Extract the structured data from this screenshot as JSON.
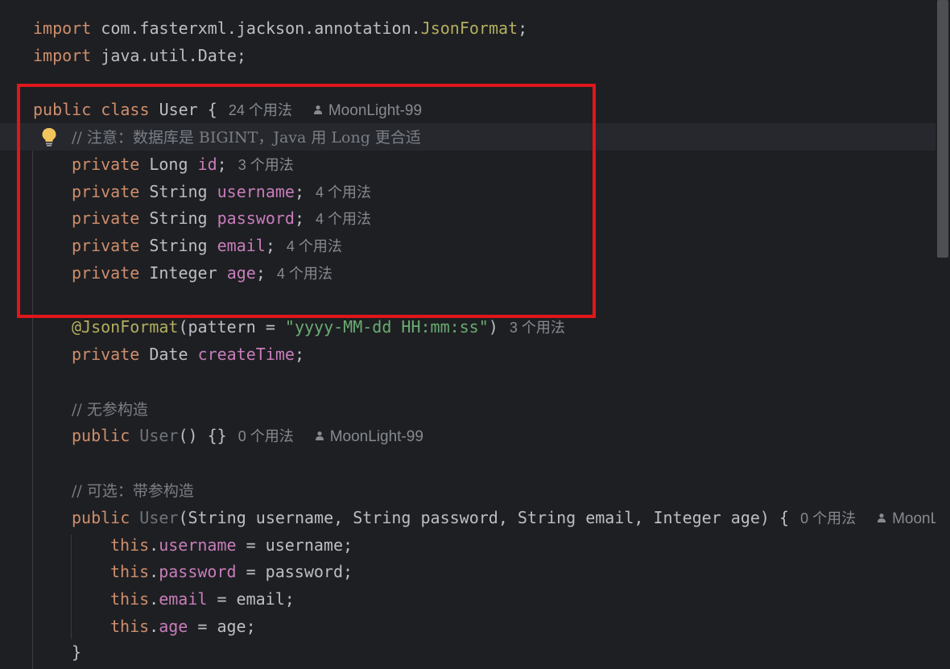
{
  "lines": {
    "l1": {
      "kw": "import",
      "rest": " com.fasterxml.jackson.annotation.",
      "cls": "JsonFormat",
      "end": ";"
    },
    "l2": {
      "kw": "import",
      "rest": " java.util.Date;"
    },
    "l3": {
      "kw1": "public",
      "kw2": "class",
      "name": "User",
      "brace": "{",
      "hint": "24 个用法",
      "author": "MoonLight-99"
    },
    "l4": {
      "comment": "// 注意：数据库是 BIGINT，Java 用 Long 更合适"
    },
    "l5": {
      "kw": "private",
      "type": "Long",
      "field": "id",
      "end": ";",
      "hint": "3 个用法"
    },
    "l6": {
      "kw": "private",
      "type": "String",
      "field": "username",
      "end": ";",
      "hint": "4 个用法"
    },
    "l7": {
      "kw": "private",
      "type": "String",
      "field": "password",
      "end": ";",
      "hint": "4 个用法"
    },
    "l8": {
      "kw": "private",
      "type": "String",
      "field": "email",
      "end": ";",
      "hint": "4 个用法"
    },
    "l9": {
      "kw": "private",
      "type": "Integer",
      "field": "age",
      "end": ";",
      "hint": "4 个用法"
    },
    "l11": {
      "ann": "@JsonFormat",
      "open": "(pattern = ",
      "str": "\"yyyy-MM-dd HH:mm:ss\"",
      "close": ")",
      "hint": "3 个用法"
    },
    "l12": {
      "kw": "private",
      "type": "Date",
      "field": "createTime",
      "end": ";"
    },
    "l14": {
      "comment": "// 无参构造"
    },
    "l15": {
      "kw": "public",
      "name": "User",
      "rest": "() {}",
      "hint": "0 个用法",
      "author": "MoonLight-99"
    },
    "l17": {
      "comment": "// 可选：带参构造"
    },
    "l18": {
      "kw": "public",
      "name": "User",
      "rest": "(String username, String password, String email, Integer age) {",
      "hint": "0 个用法",
      "author": "MoonLi"
    },
    "l19": {
      "kw": "this",
      "dot": ".",
      "field": "username",
      "rest": " = username;"
    },
    "l20": {
      "kw": "this",
      "dot": ".",
      "field": "password",
      "rest": " = password;"
    },
    "l21": {
      "kw": "this",
      "dot": ".",
      "field": "email",
      "rest": " = email;"
    },
    "l22": {
      "kw": "this",
      "dot": ".",
      "field": "age",
      "rest": " = age;"
    },
    "l23": {
      "brace": "}"
    }
  },
  "colors": {
    "background": "#1e1f22",
    "keyword": "#cf8e6d",
    "field": "#c77dbb",
    "annotation": "#b3ae60",
    "string": "#6aab73",
    "comment": "#7a7e85",
    "highlight_box": "#e0161b"
  },
  "icons": {
    "bulb": "lightbulb-icon",
    "author": "person-icon"
  }
}
